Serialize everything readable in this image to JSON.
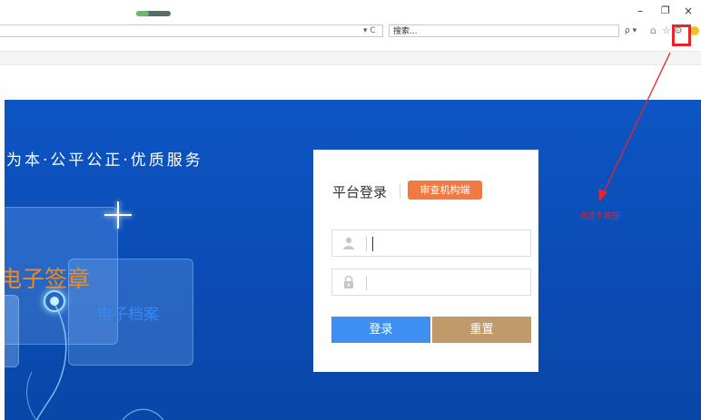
{
  "browser": {
    "search_placeholder": "搜索...",
    "search_controls": "ρ ▾",
    "address_controls": "▾ C",
    "window_controls": {
      "minimize": "–",
      "maximize": "❐",
      "close": "×"
    },
    "toolbar_icons": [
      "home-icon",
      "star-icon",
      "gear-icon",
      "smile-icon"
    ],
    "highlight_color": "#e8252a"
  },
  "hero": {
    "slogan": "为本·公平公正·优质服务",
    "label_sign": "电子签章",
    "label_archive": "电子档案",
    "background_color": "#0d55c4"
  },
  "login": {
    "title": "平台登录",
    "role_badge": "审查机构端",
    "username_value": "",
    "password_value": "",
    "login_button": "登录",
    "reset_button": "重置",
    "colors": {
      "badge": "#f07a41",
      "login": "#3e8ff2",
      "reset": "#c09a6b"
    }
  },
  "annotation": {
    "text": "点这个按钮",
    "color": "#e8252a"
  }
}
